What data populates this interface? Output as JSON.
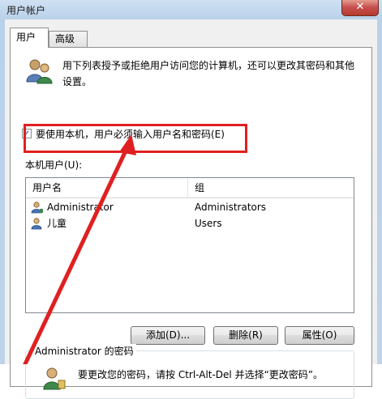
{
  "window": {
    "title": "用户帐户",
    "close_label": "✕"
  },
  "tabs": [
    {
      "label": "用户"
    },
    {
      "label": "高级"
    }
  ],
  "description": "用下列表授予或拒绝用户访问您的计算机，还可以更改其密码和其他设置。",
  "require_login_checkbox": {
    "label": "要使用本机，用户必须输入用户名和密码(E)",
    "checked": true,
    "check_glyph": "✓"
  },
  "local_users": {
    "label": "本机用户(U):",
    "columns": [
      "用户名",
      "组"
    ],
    "rows": [
      {
        "name": "Administrator",
        "group": "Administrators"
      },
      {
        "name": "儿童",
        "group": "Users"
      }
    ]
  },
  "buttons": {
    "add": "添加(D)...",
    "remove": "删除(R)",
    "properties": "属性(O)"
  },
  "password_section": {
    "title": "Administrator 的密码",
    "text": "要更改您的密码，请按 Ctrl-Alt-Del 并选择“更改密码”。"
  },
  "icons": {
    "users": "users-icon",
    "user_row": "user-icon",
    "password": "key-user-icon"
  },
  "colors": {
    "annotation_red": "#e02020",
    "panel_bg": "#ffffff",
    "window_frame": "#b9d1ea"
  }
}
